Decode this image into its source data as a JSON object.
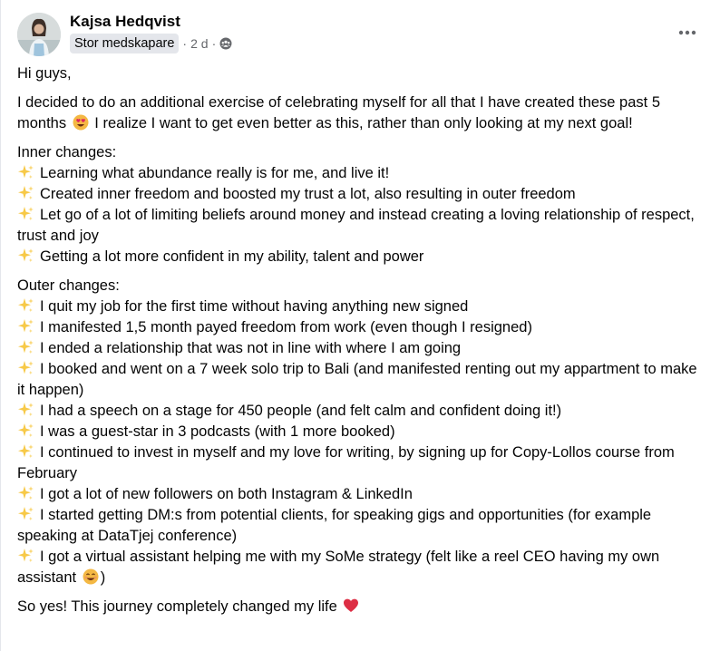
{
  "post": {
    "author": "Kajsa Hedqvist",
    "badge": "Stor medskapare",
    "separator": "·",
    "time": "2 d",
    "privacy_icon": "group-icon",
    "more_icon": "more-horizontal-icon"
  },
  "body": {
    "greeting": "Hi guys,",
    "intro": "I decided to do an additional exercise of celebrating myself for all that I have created these past 5 months",
    "intro_emoji": "heart-eyes-emoji-icon",
    "intro_rest": "I realize I want to get even better as this, rather than only looking at my next goal!",
    "inner": {
      "heading": "Inner changes:",
      "items": [
        "Learning what abundance really is for me, and live it!",
        "Created inner freedom and boosted my trust a lot, also resulting in outer freedom",
        "Let go of a lot of limiting beliefs around money and instead creating a loving relationship of respect, trust and joy",
        "Getting a lot more confident in my ability, talent and power"
      ]
    },
    "outer": {
      "heading": "Outer changes:",
      "items": [
        "I quit my job for the first time without having anything new signed",
        "I manifested 1,5 month payed freedom from work (even though I resigned)",
        "I ended a relationship that was not in line with where I am going",
        "I booked and went on a 7 week solo trip to Bali (and manifested renting out my appartment to make it happen)",
        "I had a speech on a stage for 450 people (and felt calm and confident doing it!)",
        "I was a guest-star in 3 podcasts (with 1 more booked)",
        "I continued to invest in myself and my love for writing, by signing up for Copy-Lollos course from February",
        "I got a lot of new followers on both Instagram & LinkedIn",
        "I started getting DM:s from potential clients, for speaking gigs and opportunities (for example speaking at DataTjej conference)",
        "I got a virtual assistant helping me with my SoMe strategy (felt like a reel CEO having my own assistant"
      ],
      "last_item_emoji": "smiling-emoji-icon",
      "last_item_close": ")"
    },
    "closing": "So yes! This journey completely changed my life",
    "closing_emoji": "red-heart-emoji-icon"
  },
  "colors": {
    "text": "#050505",
    "secondary": "#65676b",
    "badge_bg": "#e4e6eb",
    "sparkle": "#f7c948"
  }
}
